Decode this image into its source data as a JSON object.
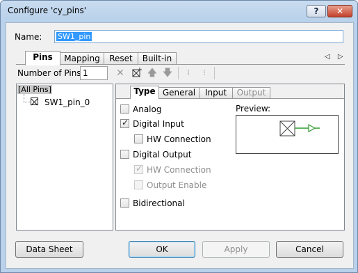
{
  "window": {
    "title": "Configure 'cy_pins'",
    "help_label": "?",
    "close_label": "✕"
  },
  "name": {
    "label": "Name:",
    "value": "SW1_pin"
  },
  "top_tabs": [
    "Pins",
    "Mapping",
    "Reset",
    "Built-in"
  ],
  "top_tab_arrows": "◁ ▷",
  "pins": {
    "count_label": "Number of Pins:",
    "count_value": "1",
    "toolbar_icons": [
      "delete-icon",
      "add-pin-icon",
      "move-up-icon",
      "move-down-icon",
      "spread-icon",
      "collapse-icon"
    ],
    "tree_root": "[All Pins]",
    "tree_items": [
      "SW1_pin_0"
    ]
  },
  "type_tabs": [
    "Type",
    "General",
    "Input",
    "Output"
  ],
  "type": {
    "analog": {
      "label": "Analog",
      "checked": false
    },
    "digital_input": {
      "label": "Digital Input",
      "checked": true
    },
    "di_hw_connection": {
      "label": "HW Connection",
      "checked": false
    },
    "digital_output": {
      "label": "Digital Output",
      "checked": false
    },
    "do_hw_connection": {
      "label": "HW Connection",
      "checked": true
    },
    "output_enable": {
      "label": "Output Enable",
      "checked": false
    },
    "bidirectional": {
      "label": "Bidirectional",
      "checked": false
    },
    "preview_label": "Preview:"
  },
  "colors": {
    "preview_wire": "#2e9b2e",
    "selection": "#3399ff"
  },
  "buttons": {
    "datasheet": "Data Sheet",
    "ok": "OK",
    "apply": "Apply",
    "cancel": "Cancel"
  }
}
